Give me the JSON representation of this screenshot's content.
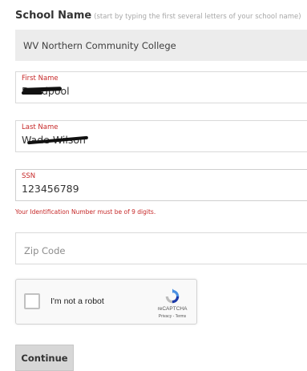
{
  "school": {
    "label": "School Name",
    "hint": "(start by typing the first several letters of your school name)",
    "value": "WV Northern Community College"
  },
  "first_name": {
    "label": "First Name",
    "value": "Deadpool"
  },
  "last_name": {
    "label": "Last Name",
    "value": "Wade Wilson"
  },
  "ssn": {
    "label": "SSN",
    "value": "123456789",
    "error": "Your Identification Number must be of 9 digits."
  },
  "zip": {
    "placeholder": "Zip Code",
    "value": ""
  },
  "captcha": {
    "label": "I'm not a robot",
    "brand": "reCAPTCHA",
    "privacy": "Privacy",
    "separator": " - ",
    "terms": "Terms"
  },
  "actions": {
    "continue_label": "Continue"
  },
  "colors": {
    "error": "#c62828",
    "field_background": "#ececec",
    "button_background": "#d7d7d7"
  }
}
